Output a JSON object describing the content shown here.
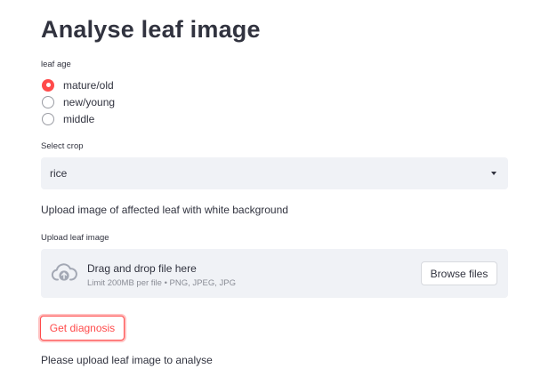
{
  "page": {
    "title": "Analyse leaf image"
  },
  "leaf_age": {
    "label": "leaf age",
    "options": [
      {
        "label": "mature/old",
        "selected": true
      },
      {
        "label": "new/young",
        "selected": false
      },
      {
        "label": "middle",
        "selected": false
      }
    ]
  },
  "crop_select": {
    "label": "Select crop",
    "value": "rice",
    "icon": "caret-down-icon"
  },
  "instructions": {
    "text": "Upload image of affected leaf with white background"
  },
  "uploader": {
    "label": "Upload leaf image",
    "drop_title": "Drag and drop file here",
    "drop_hint": "Limit 200MB per file • PNG, JPEG, JPG",
    "browse_label": "Browse files",
    "icon": "cloud-upload-icon"
  },
  "diagnosis_button": {
    "label": "Get diagnosis"
  },
  "status": {
    "message": "Please upload leaf image to analyse"
  },
  "colors": {
    "accent": "#ff4b4b",
    "text": "#31333f",
    "input_bg": "#f0f2f6",
    "muted_text": "#8a8d96"
  }
}
